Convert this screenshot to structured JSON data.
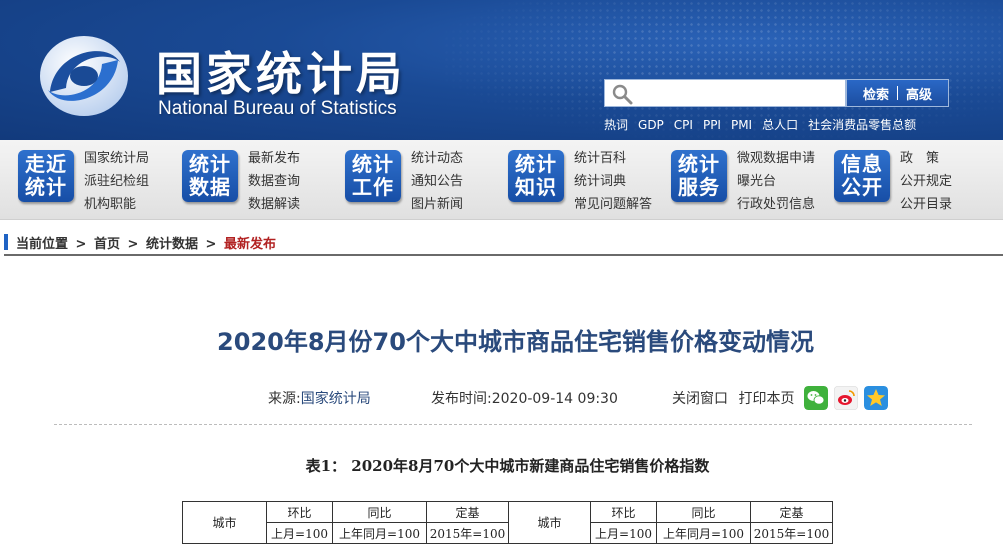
{
  "header": {
    "brand_cn": "国家统计局",
    "brand_en": "National Bureau of Statistics",
    "search": {
      "placeholder": "",
      "button_search": "检索",
      "button_advanced": "高级"
    },
    "hotwords": [
      "热词",
      "GDP",
      "CPI",
      "PPI",
      "PMI",
      "总人口",
      "社会消费品零售总额"
    ]
  },
  "nav": [
    {
      "tile": [
        "走近",
        "统计"
      ],
      "links": [
        "国家统计局",
        "派驻纪检组",
        "机构职能"
      ]
    },
    {
      "tile": [
        "统计",
        "数据"
      ],
      "links": [
        "最新发布",
        "数据查询",
        "数据解读"
      ]
    },
    {
      "tile": [
        "统计",
        "工作"
      ],
      "links": [
        "统计动态",
        "通知公告",
        "图片新闻"
      ]
    },
    {
      "tile": [
        "统计",
        "知识"
      ],
      "links": [
        "统计百科",
        "统计词典",
        "常见问题解答"
      ]
    },
    {
      "tile": [
        "统计",
        "服务"
      ],
      "links": [
        "微观数据申请",
        "曝光台",
        "行政处罚信息"
      ]
    },
    {
      "tile": [
        "信息",
        "公开"
      ],
      "links": [
        "政　策",
        "公开规定",
        "公开目录"
      ]
    }
  ],
  "breadcrumb": {
    "label": "当前位置",
    "home": "首页",
    "section": "统计数据",
    "current": "最新发布",
    "separator": ">"
  },
  "article": {
    "title": "2020年8月份70个大中城市商品住宅销售价格变动情况",
    "source_label": "来源:",
    "source": "国家统计局",
    "date_label": "发布时间:",
    "date": "2020-09-14 09:30",
    "close_window": "关闭窗口",
    "print_page": "打印本页",
    "share_icons": [
      "wechat-icon",
      "weibo-icon",
      "qzone-icon"
    ],
    "colors": {
      "title": "#2a4a7c",
      "brand_blue": "#1a4a95",
      "current_crumb": "#b22222"
    }
  },
  "table": {
    "caption": "表1： 2020年8月70个大中城市新建商品住宅销售价格指数",
    "city_header": "城市",
    "groups": [
      "环比",
      "同比",
      "定基"
    ],
    "subheaders": [
      "上月=100",
      "上年同月=100",
      "2015年=100"
    ]
  }
}
